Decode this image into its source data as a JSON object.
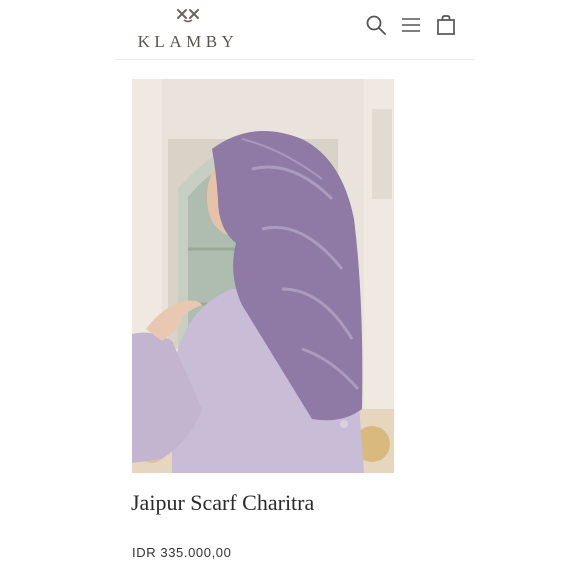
{
  "header": {
    "brand_name": "KLAMBY",
    "brand_icon": "klamby-logo-mark",
    "icons": [
      "search-icon",
      "menu-icon",
      "shopping-bag-icon"
    ]
  },
  "product": {
    "image": "model-wearing-lilac-printed-scarf",
    "title": "Jaipur Scarf Charitra",
    "price": "IDR 335.000,00"
  },
  "colors": {
    "scarf": "#8e7aa5",
    "dress": "#c9bcd6",
    "background": "#e9e3dc"
  }
}
